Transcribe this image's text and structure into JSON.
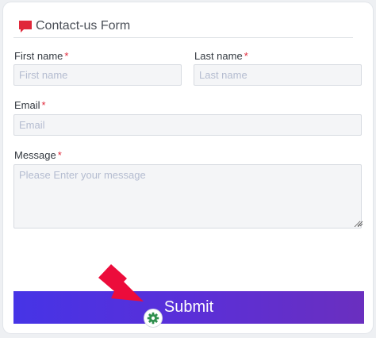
{
  "form": {
    "title": "Contact-us Form",
    "required_mark": "*",
    "fields": {
      "first_name": {
        "label": "First name",
        "placeholder": "First name",
        "value": ""
      },
      "last_name": {
        "label": "Last name",
        "placeholder": "Last name",
        "value": ""
      },
      "email": {
        "label": "Email",
        "placeholder": "Email",
        "value": ""
      },
      "message": {
        "label": "Message",
        "placeholder": "Please Enter your message",
        "value": ""
      }
    },
    "submit_label": "Submit"
  },
  "icons": {
    "header": "chat-bubble-icon",
    "gear": "gear-icon",
    "arrow": "arrow-pointer-icon"
  },
  "colors": {
    "header_icon": "#e0283a",
    "required": "#e0283a",
    "button_start": "#4634e6",
    "button_end": "#6a2fbf",
    "arrow": "#ec0c3b",
    "gear": "#2f8f4e"
  }
}
